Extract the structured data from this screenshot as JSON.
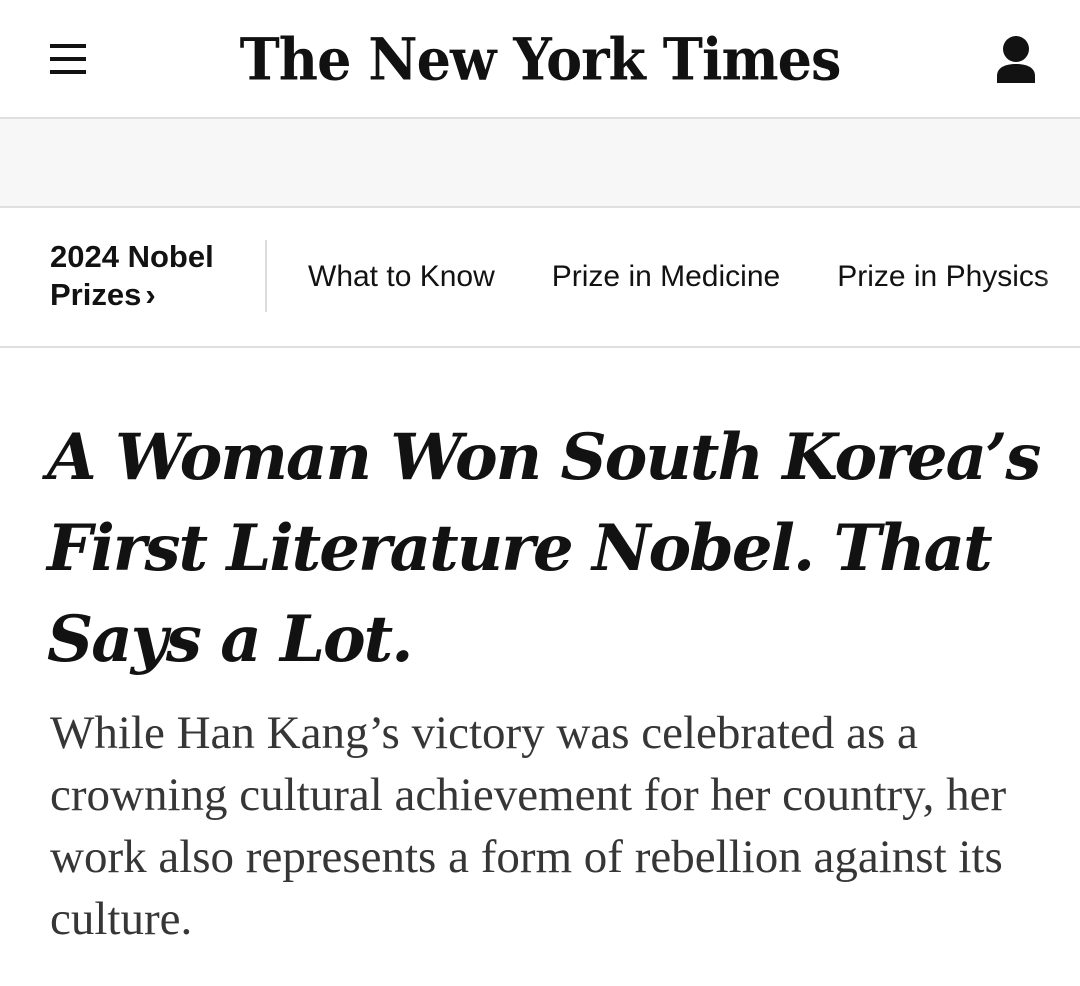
{
  "header": {
    "logo_text": "The New York Times",
    "menu_icon": "hamburger-menu-icon",
    "account_icon": "user-account-icon"
  },
  "subnav": {
    "title": "2024 Nobel Prizes",
    "links": [
      "What to Know",
      "Prize in Medicine",
      "Prize in Physics"
    ]
  },
  "article": {
    "headline": "A Woman Won South Korea’s First Literature Nobel. That Says a Lot.",
    "summary": "While Han Kang’s victory was celebrated as a crowning cultural achievement for her country, her work also represents a form of rebellion against its culture."
  },
  "colors": {
    "text": "#121212",
    "summary_text": "#363636",
    "divider": "#dfdfdf",
    "ad_background": "#f7f7f7"
  }
}
